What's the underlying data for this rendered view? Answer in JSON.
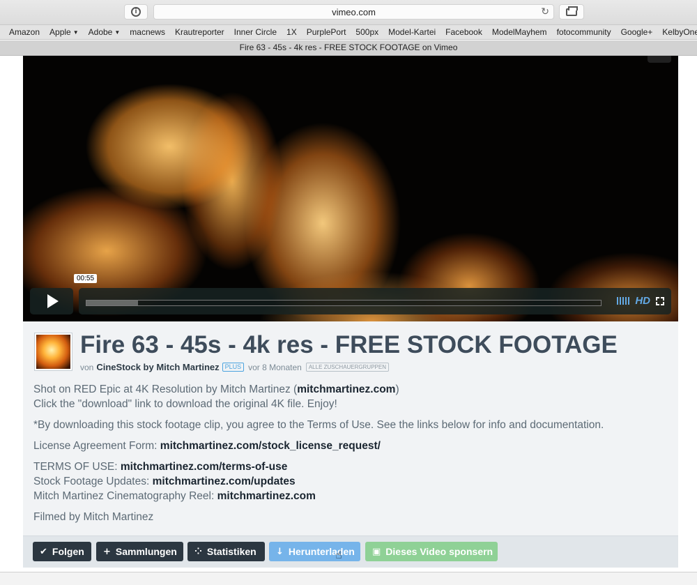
{
  "browser": {
    "url": "vimeo.com",
    "bookmarks": [
      {
        "label": "Amazon",
        "menu": false
      },
      {
        "label": "Apple",
        "menu": true
      },
      {
        "label": "Adobe",
        "menu": true
      },
      {
        "label": "macnews",
        "menu": false
      },
      {
        "label": "Krautreporter",
        "menu": false
      },
      {
        "label": "Inner Circle",
        "menu": false
      },
      {
        "label": "1X",
        "menu": false
      },
      {
        "label": "PurplePort",
        "menu": false
      },
      {
        "label": "500px",
        "menu": false
      },
      {
        "label": "Model-Kartei",
        "menu": false
      },
      {
        "label": "Facebook",
        "menu": false
      },
      {
        "label": "ModelMayhem",
        "menu": false
      },
      {
        "label": "fotocommunity",
        "menu": false
      },
      {
        "label": "Google+",
        "menu": false
      },
      {
        "label": "KelbyOne",
        "menu": false
      }
    ],
    "tab_title": "Fire 63 - 45s - 4k res - FREE STOCK FOOTAGE on Vimeo"
  },
  "player": {
    "time": "00:55",
    "progress_fraction": 0.1,
    "hd_label": "HD"
  },
  "video": {
    "title": "Fire 63 - 45s - 4k res - FREE STOCK FOOTAGE",
    "by_prefix": "von",
    "author": "CineStock by Mitch Martinez",
    "plus_badge": "PLUS",
    "age": "vor 8 Monaten",
    "privacy_badge": "ALLE ZUSCHAUERGRUPPEN"
  },
  "description": {
    "line1_text": "Shot on RED Epic at 4K Resolution by Mitch Martinez (",
    "line1_link": "mitchmartinez.com",
    "line1_end": ")",
    "line2": "Click the \"download\" link to download the original 4K file. Enjoy!",
    "terms_note": "*By downloading this stock footage clip, you agree to the Terms of Use. See the links below for info and documentation.",
    "license_label": "License Agreement Form: ",
    "license_link": "mitchmartinez.com/stock_license_request/",
    "terms_label": "TERMS OF USE: ",
    "terms_link": "mitchmartinez.com/terms-of-use",
    "updates_label": "Stock Footage Updates: ",
    "updates_link": "mitchmartinez.com/updates",
    "reel_label": "Mitch Martinez Cinematography Reel: ",
    "reel_link": "mitchmartinez.com",
    "filmed_by": "Filmed by Mitch Martinez"
  },
  "actions": {
    "follow": "Folgen",
    "collections": "Sammlungen",
    "stats": "Statistiken",
    "download": "Herunterladen",
    "sponsor": "Dieses Video sponsern"
  },
  "colors": {
    "title": "#3e4c5b",
    "dark_button": "#2c3741",
    "download_button": "#76b4ea",
    "sponsor_button": "#8fd196",
    "player_accent": "#63a9e5"
  }
}
